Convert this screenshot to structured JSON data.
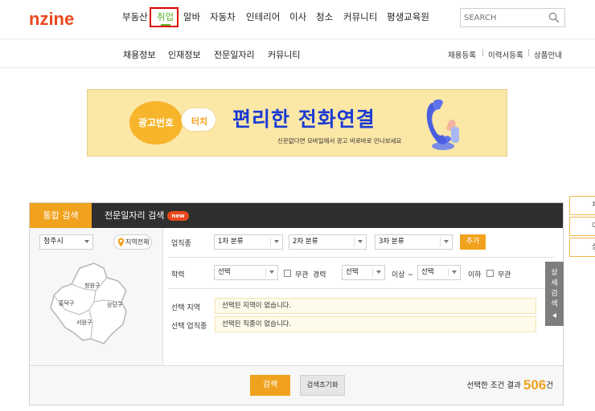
{
  "header": {
    "logo": "nzine",
    "nav": [
      "부동산",
      "취업",
      "알바",
      "자동차",
      "인테리어",
      "이사",
      "청소",
      "커뮤니티",
      "평생교육원"
    ],
    "active_nav": "취업",
    "search_placeholder": "SEARCH"
  },
  "subnav": {
    "items": [
      "채용정보",
      "인재정보",
      "전문일자리",
      "커뮤니티"
    ],
    "util_links": [
      "채용등록",
      "이력서등록",
      "상품안내"
    ]
  },
  "banner": {
    "bubble1": "광고번호",
    "bubble2": "터치",
    "title": "편리한 전화연결",
    "subtitle": "신문없다면 모바일에서 광고 바로바로 만나보세요"
  },
  "search_panel": {
    "tabs": [
      {
        "label": "통합 검색",
        "active": true
      },
      {
        "label": "전문일자리 검색",
        "badge": "new"
      }
    ],
    "region": {
      "city": "청주시",
      "all_region": "지역전체",
      "districts": [
        "청원구",
        "흥덕구",
        "상당구",
        "서원구"
      ]
    },
    "job_category": {
      "label": "업직종",
      "first": "1차 분류",
      "second": "2차 분류",
      "third": "3차 분류",
      "add_button": "추가"
    },
    "education": {
      "label": "학력",
      "value": "선택",
      "no_matter": "무관"
    },
    "career": {
      "label": "경력",
      "min": "선택",
      "above": "이상 ~",
      "max": "선택",
      "below": "이하",
      "no_matter": "무관"
    },
    "selected_region": {
      "label": "선택 지역",
      "value": "선택된 지역이 없습니다."
    },
    "selected_job": {
      "label": "선택 업직종",
      "value": "선택된 직종이 없습니다."
    },
    "detail_search": "상세검색",
    "search_button": "검색",
    "reset_button": "검색초기화",
    "result": {
      "prefix": "선택한 조건 결과",
      "count": "506",
      "suffix": "건"
    }
  },
  "side_tabs": [
    "채",
    "이",
    "상"
  ],
  "colors": {
    "brand": "#e8491d",
    "accent": "#f0a21e",
    "active_nav": "#5db52b",
    "highlight_box": "#e00000",
    "banner_title": "#1b3bd4"
  }
}
